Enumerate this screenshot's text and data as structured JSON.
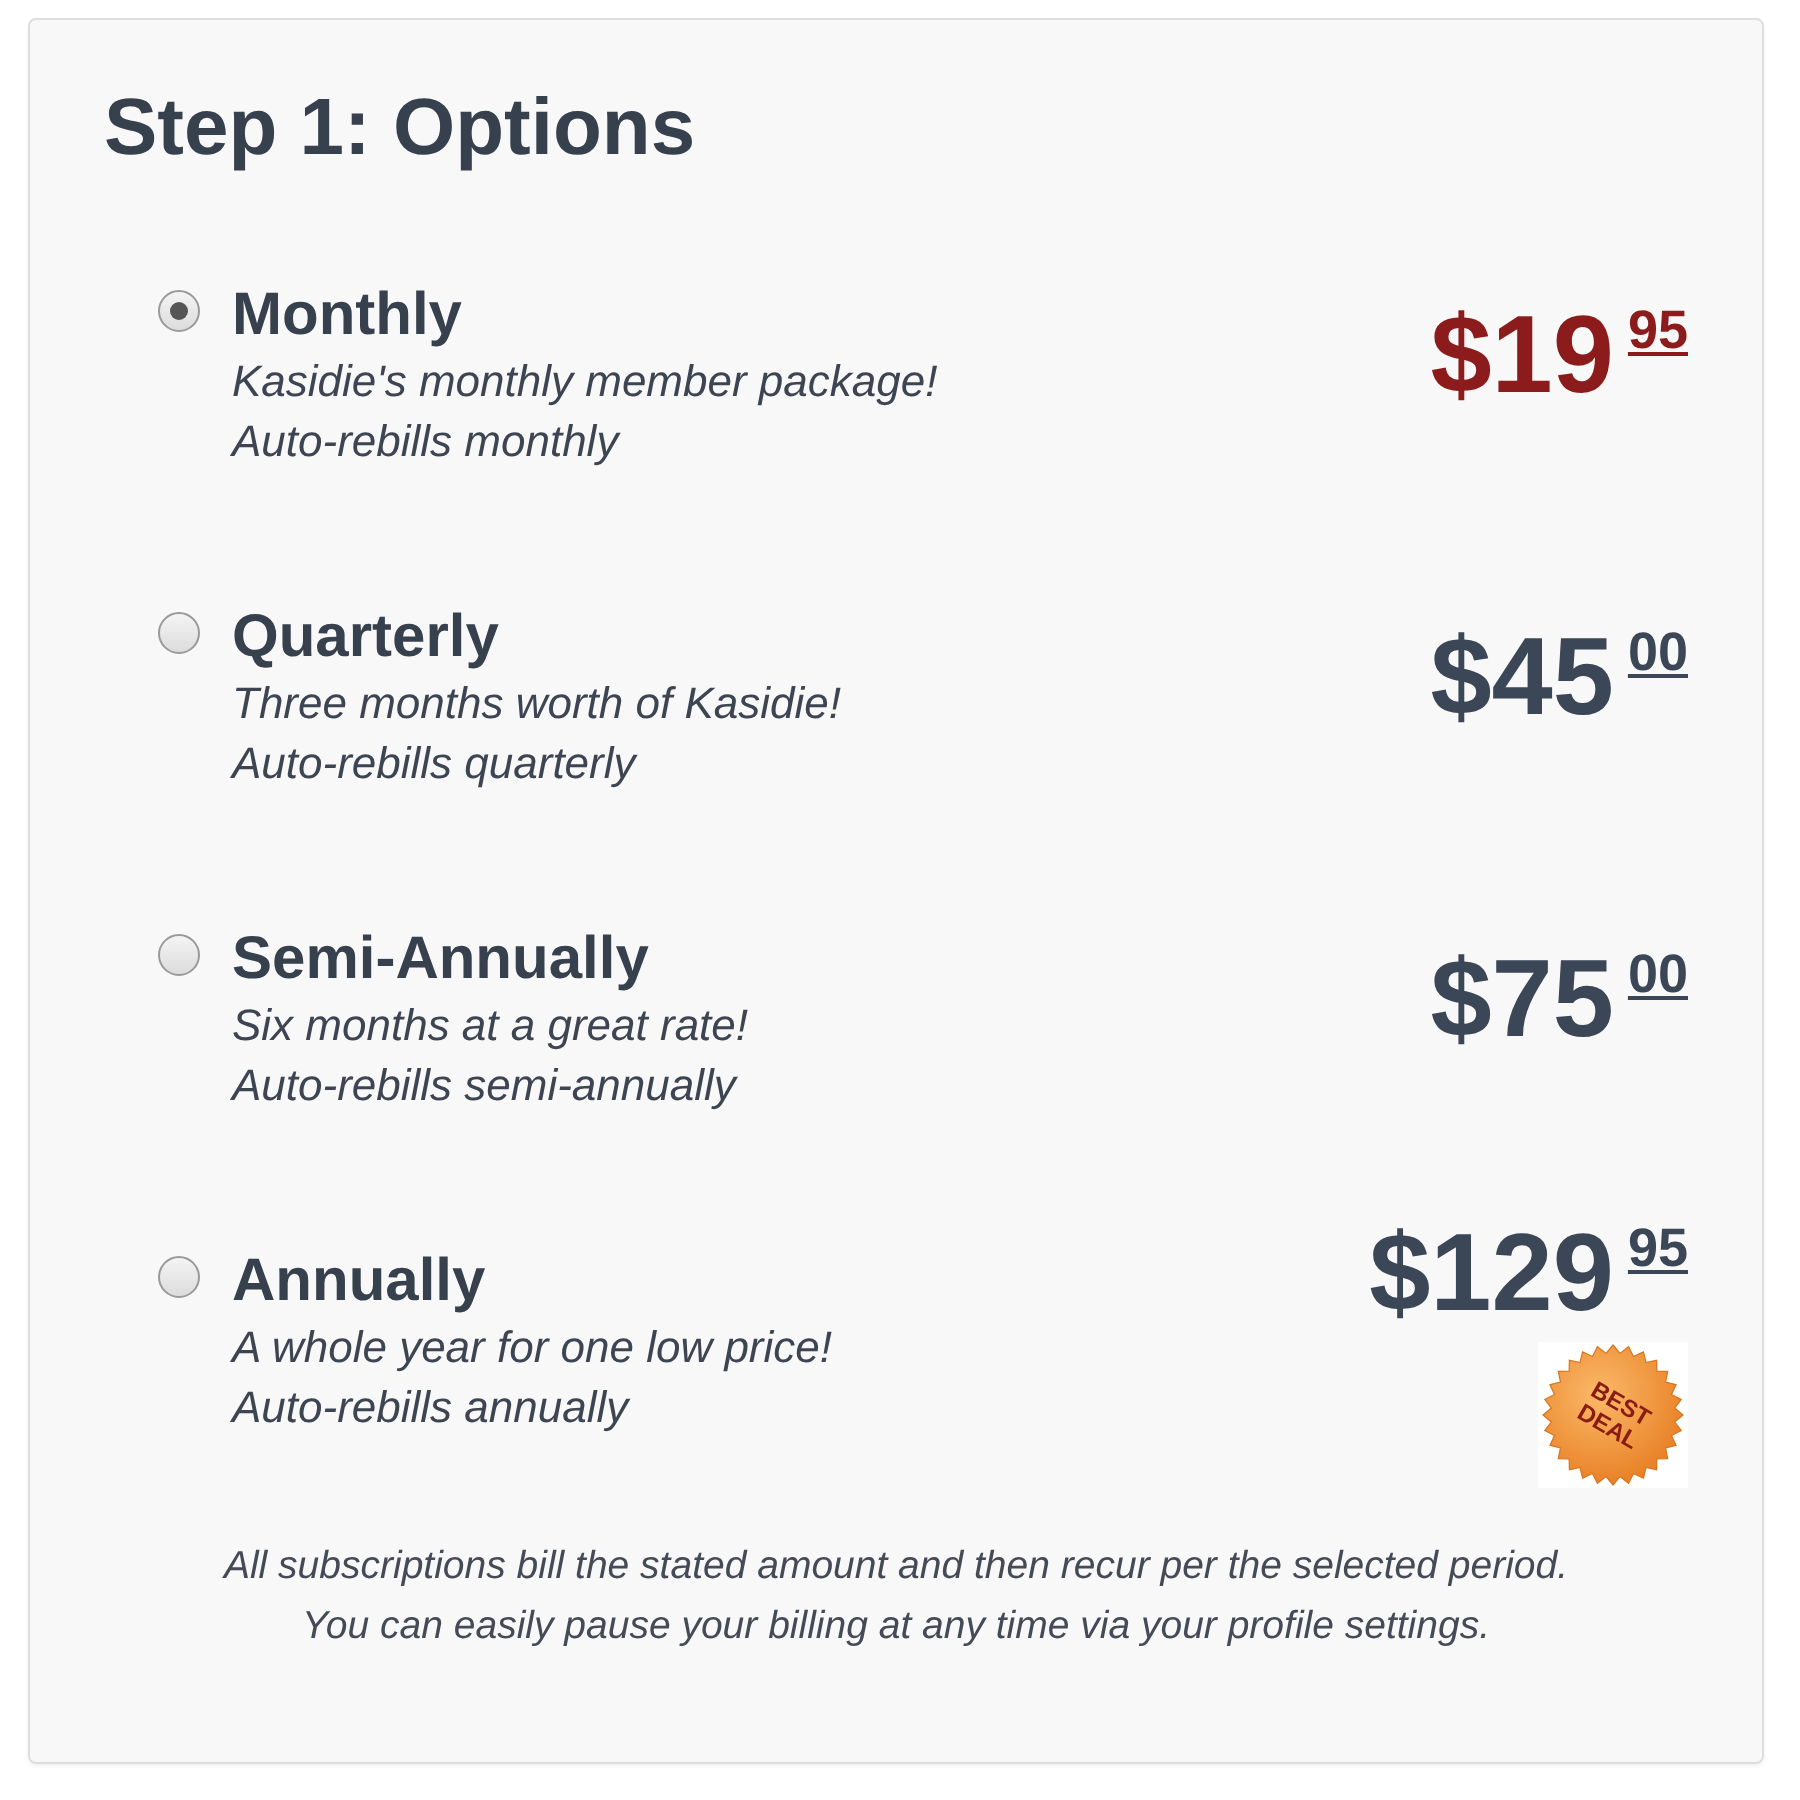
{
  "title": "Step 1: Options",
  "options": [
    {
      "name": "Monthly",
      "description": "Kasidie's monthly member package!",
      "billing": "Auto-rebills monthly",
      "price": "$19",
      "cents": "95",
      "selected": true
    },
    {
      "name": "Quarterly",
      "description": "Three months worth of Kasidie!",
      "billing": "Auto-rebills quarterly",
      "price": "$45",
      "cents": "00",
      "selected": false
    },
    {
      "name": "Semi-Annually",
      "description": "Six months at a great rate!",
      "billing": "Auto-rebills semi-annually",
      "price": "$75",
      "cents": "00",
      "selected": false
    },
    {
      "name": "Annually",
      "description": "A whole year for one low price!",
      "billing": "Auto-rebills annually",
      "price": "$129",
      "cents": "95",
      "selected": false,
      "badge": "BEST DEAL"
    }
  ],
  "footnote_lines": [
    "All subscriptions bill the stated amount and then recur per the selected period.",
    "You can easily pause your billing at any time via your profile settings."
  ]
}
